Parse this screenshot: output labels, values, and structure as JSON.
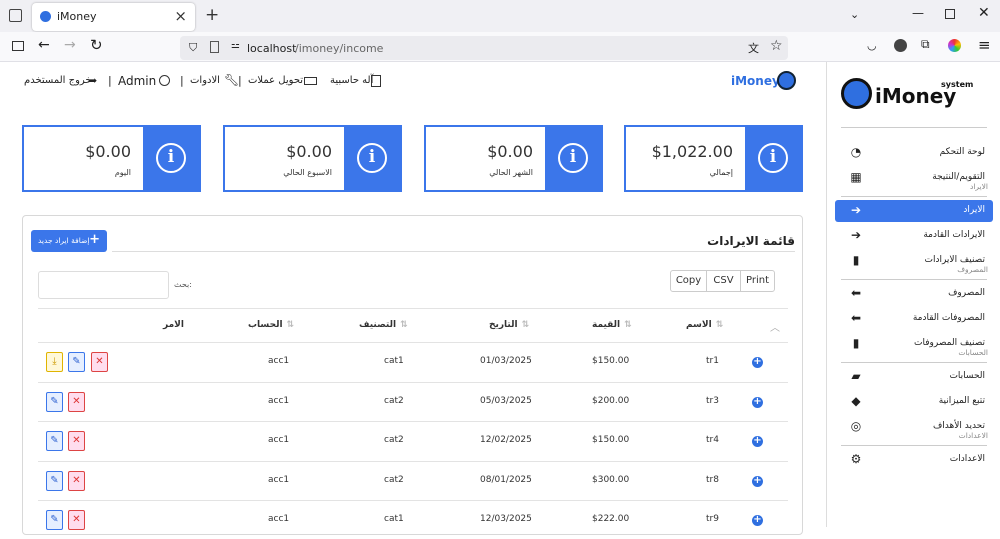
{
  "browser": {
    "tab_title": "iMoney",
    "url_host": "localhost",
    "url_path": "/imoney/income",
    "close": "×",
    "new_tab": "+"
  },
  "topbar": {
    "logout": "خروج المستخدم",
    "user": "Admin",
    "tools": "الادوات",
    "currency": "تحويل عملات",
    "calculator": "آله حاسبية",
    "brand": "iMoney",
    "sep": "|"
  },
  "cards": [
    {
      "amount": "$1,022.00",
      "label": "إجمالي"
    },
    {
      "amount": "$0.00",
      "label": "الشهر الحالي"
    },
    {
      "amount": "$0.00",
      "label": "الاسبوع الحالي"
    },
    {
      "amount": "$0.00",
      "label": "اليوم"
    }
  ],
  "info_glyph": "i",
  "panel": {
    "title": "قائمة الايرادات",
    "add_button": "إضافة ايراد جديد",
    "search_label": "بحث:",
    "search_value": "",
    "buttons": {
      "copy": "Copy",
      "csv": "CSV",
      "print": "Print"
    }
  },
  "table": {
    "headers": {
      "name": "الاسم",
      "value": "القيمة",
      "date": "التاريخ",
      "category": "التصنيف",
      "account": "الحساب",
      "action": "الامر"
    },
    "rows": [
      {
        "name": "tr1",
        "value": "$150.00",
        "date": "01/03/2025",
        "category": "cat1",
        "account": "acc1",
        "download": true
      },
      {
        "name": "tr3",
        "value": "$200.00",
        "date": "05/03/2025",
        "category": "cat2",
        "account": "acc1",
        "download": false
      },
      {
        "name": "tr4",
        "value": "$150.00",
        "date": "12/02/2025",
        "category": "cat2",
        "account": "acc1",
        "download": false
      },
      {
        "name": "tr8",
        "value": "$300.00",
        "date": "08/01/2025",
        "category": "cat2",
        "account": "acc1",
        "download": false
      },
      {
        "name": "tr9",
        "value": "$222.00",
        "date": "12/03/2025",
        "category": "cat1",
        "account": "acc1",
        "download": false
      }
    ]
  },
  "sidebar": {
    "logo_text": "iMoney",
    "logo_sub": "system",
    "items": [
      {
        "label": "لوحة التحكم",
        "icon": "dashboard-icon",
        "glyph": "◔"
      },
      {
        "label": "التقويم/النتيجة",
        "icon": "calendar-icon",
        "glyph": "▦"
      },
      {
        "section": "الايراد"
      },
      {
        "label": "الايراد",
        "icon": "arrow-right-icon",
        "glyph": "➔",
        "active": true
      },
      {
        "label": "الايرادات القادمة",
        "icon": "arrow-right-icon",
        "glyph": "➔"
      },
      {
        "label": "تصنيف الايرادات",
        "icon": "bookmark-icon",
        "glyph": "▮"
      },
      {
        "section": "المصروف"
      },
      {
        "label": "المصروف",
        "icon": "arrow-left-icon",
        "glyph": "⬅"
      },
      {
        "label": "المصروفات القادمة",
        "icon": "arrow-left-icon",
        "glyph": "⬅"
      },
      {
        "label": "تصنيف المصروفات",
        "icon": "bookmark-icon",
        "glyph": "▮"
      },
      {
        "section": "الحسابات"
      },
      {
        "label": "الحسابات",
        "icon": "folder-icon",
        "glyph": "▰"
      },
      {
        "label": "تتبع الميزانية",
        "icon": "tags-icon",
        "glyph": "◆"
      },
      {
        "label": "تحديد الأهداف",
        "icon": "lifebuoy-icon",
        "glyph": "◎"
      },
      {
        "section": "الاعدادات"
      },
      {
        "label": "الاعدادات",
        "icon": "gear-icon",
        "glyph": "⚙"
      }
    ]
  },
  "colors": {
    "accent": "#3b76ea",
    "active_bg": "#3b76ea"
  }
}
